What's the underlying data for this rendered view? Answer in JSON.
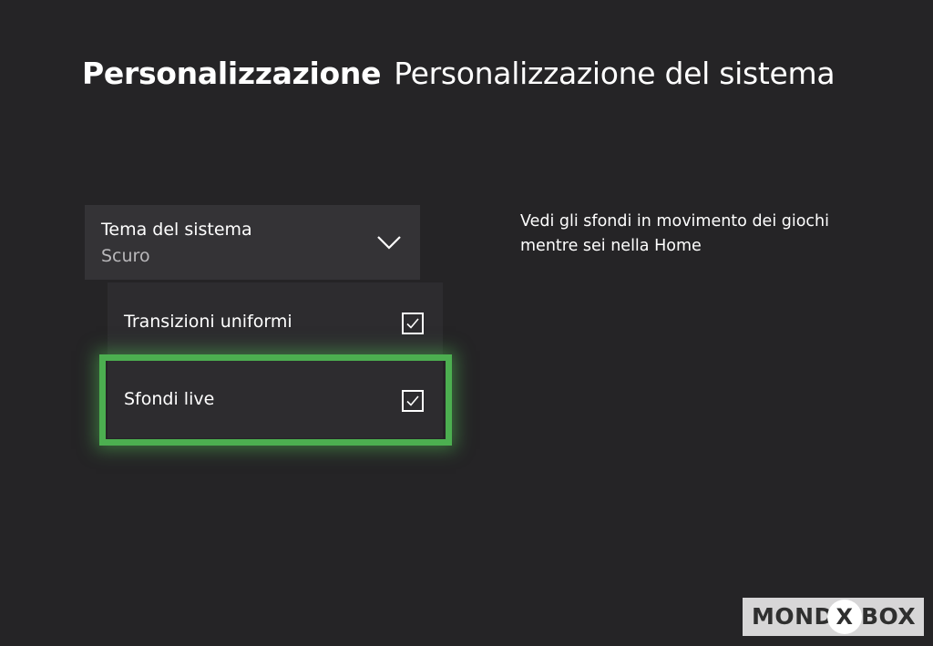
{
  "header": {
    "section": "Personalizzazione",
    "page": "Personalizzazione del sistema"
  },
  "theme_dropdown": {
    "label": "Tema del sistema",
    "value": "Scuro",
    "icon": "chevron-down-icon"
  },
  "options": [
    {
      "label": "Transizioni uniformi",
      "checked": true
    },
    {
      "label": "Sfondi live",
      "checked": true,
      "focused": true
    }
  ],
  "description": "Vedi gli sfondi in movimento dei giochi mentre sei nella Home",
  "watermark": {
    "left": "MOND",
    "mark": "X",
    "right": "BOX"
  },
  "colors": {
    "background": "#252426",
    "focus_ring": "#4caf50",
    "dropdown_bg": "#343336",
    "secondary_text": "#b9b8bb"
  }
}
